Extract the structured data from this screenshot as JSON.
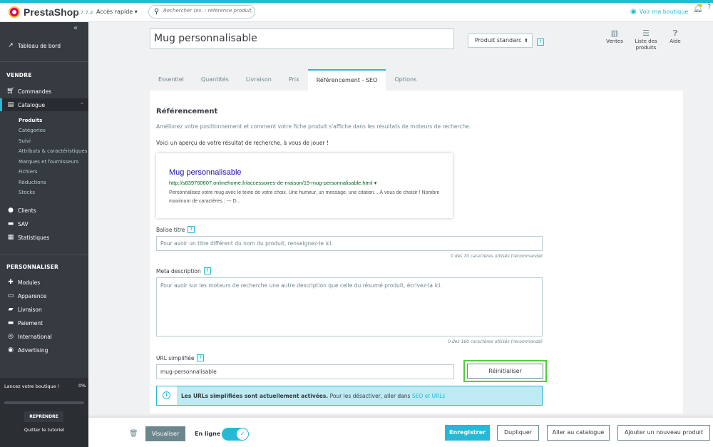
{
  "app": {
    "logo_text": "PrestaShop",
    "version": "1.7.7.2",
    "quick_access": "Accès rapide ▾",
    "search_placeholder": "Rechercher (ex. : référence produit, nom",
    "view_shop": "Voir ma boutique",
    "accent_color": "#25b9d7",
    "icons": [
      "search-icon",
      "eye-icon",
      "bell-icon",
      "help-icon"
    ]
  },
  "sidebar": {
    "collapse_icon": "«",
    "dashboard": "Tableau de bord",
    "section_sell": "VENDRE",
    "orders": "Commandes",
    "catalog": "Catalogue",
    "catalog_sub": [
      "Produits",
      "Catégories",
      "Suivi",
      "Attributs & caractéristiques",
      "Marques et fournisseurs",
      "Fichiers",
      "Réductions",
      "Stocks"
    ],
    "clients": "Clients",
    "sav": "SAV",
    "stats": "Statistiques",
    "section_custom": "PERSONNALISER",
    "modules": "Modules",
    "appearance": "Apparence",
    "shipping": "Livraison",
    "payment": "Paiement",
    "international": "International",
    "advertising": "Advertising",
    "launch": {
      "text": "Lancez votre boutique !",
      "percent": "0%",
      "progress": 0,
      "button": "REPRENDRE",
      "quit": "Quitter le tutoriel"
    }
  },
  "header": {
    "product_name": "Mug personnalisable",
    "product_type": "Produit standarc",
    "help": "?",
    "toolbar": [
      {
        "label": "Ventes",
        "icon": "chart-icon"
      },
      {
        "label": "Liste des produits",
        "icon": "list-icon"
      },
      {
        "label": "Aide",
        "icon": "help-icon"
      }
    ]
  },
  "tabs": [
    "Essentiel",
    "Quantités",
    "Livraison",
    "Prix",
    "Référencement - SEO",
    "Options"
  ],
  "active_tab": "Référencement - SEO",
  "seo": {
    "heading": "Référencement",
    "description": "Améliorez votre positionnement et comment votre fiche produit s'affiche dans les résultats de moteurs de recherche.",
    "preview_intro": "Voici un aperçu de votre résultat de recherche, à vous de jouer !",
    "preview": {
      "title": "Mug personnalisable",
      "url": "http://s839760607.onlinehome.fr/accessoires-de-maison/19-mug-personnalisable.html",
      "url_arrow": "▾",
      "description": "Personnalisez votre mug avec le texte de votre choix. Une humeur, un message, une citation... À vous de choisir ! Nombre maximum de caractères : --- D..."
    },
    "meta_title_label": "Balise titre",
    "meta_title_placeholder": "Pour avoir un titre différent du nom du produit, renseignez-le ici.",
    "meta_title_counter": "0 des 70 caractères utilisés (recommandé)",
    "meta_desc_label": "Meta description",
    "meta_desc_placeholder": "Pour avoir sur les moteurs de recherche une autre description que celle du résumé produit, écrivez-la ici.",
    "meta_desc_counter": "0 des 160 caractères utilisés (recommandé)",
    "url_label": "URL simplifiée",
    "url_value": "mug-personnalisable",
    "reset_button": "Réinitialiser",
    "alert_bold": "Les URLs simplifiées sont actuellement activées.",
    "alert_text": " Pour les désactiver, aller dans ",
    "alert_link": "SEO et URLs",
    "help": "?"
  },
  "footer": {
    "preview_button": "Visualiser",
    "online_label": "En ligne",
    "online_state": true,
    "save": "Enregistrer",
    "duplicate": "Dupliquer",
    "go_catalog": "Aller au catalogue",
    "add_new": "Ajouter un nouveau produit"
  }
}
